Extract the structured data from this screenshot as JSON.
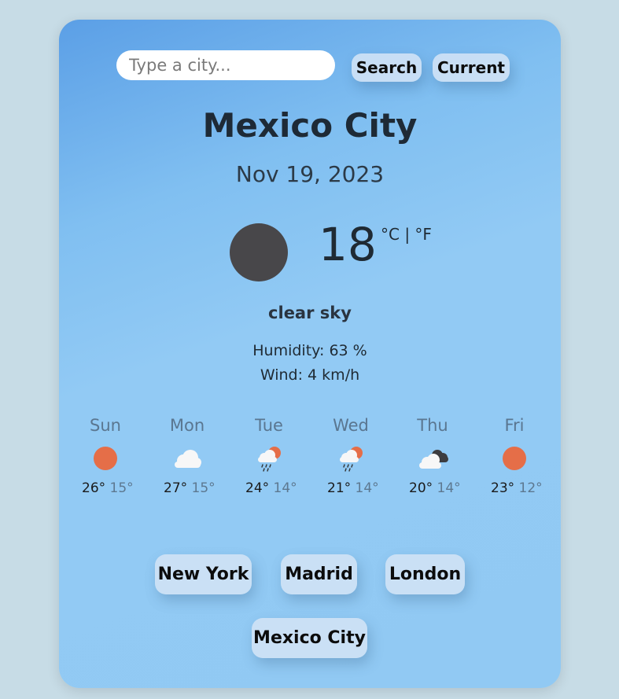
{
  "search": {
    "placeholder": "Type a city..."
  },
  "buttons": {
    "search": "Search",
    "current": "Current"
  },
  "weather": {
    "city": "Mexico City",
    "date": "Nov 19, 2023",
    "temperature": "18",
    "units": "°C | °F",
    "description": "clear sky",
    "humidity": "Humidity: 63 %",
    "wind": "Wind: 4 km/h"
  },
  "forecast": [
    {
      "day": "Sun",
      "max": "26°",
      "min": "15°",
      "icon": "sun-icon"
    },
    {
      "day": "Mon",
      "max": "27°",
      "min": "15°",
      "icon": "cloud-icon"
    },
    {
      "day": "Tue",
      "max": "24°",
      "min": "14°",
      "icon": "rain-cloud-sun-icon"
    },
    {
      "day": "Wed",
      "max": "21°",
      "min": "14°",
      "icon": "rain-cloud-sun-icon"
    },
    {
      "day": "Thu",
      "max": "20°",
      "min": "14°",
      "icon": "dark-clouds-icon"
    },
    {
      "day": "Fri",
      "max": "23°",
      "min": "12°",
      "icon": "sun-icon"
    }
  ],
  "quick_cities": [
    "New York",
    "Madrid",
    "London",
    "Mexico City"
  ],
  "colors": {
    "sun": "#e56e48",
    "cloud": "#f7f7f7",
    "dark_cloud": "#3c3c3f",
    "current_icon": "#48474a",
    "card_gradient_start": "#5b9fe6",
    "card_gradient_end": "#91c9f3"
  }
}
